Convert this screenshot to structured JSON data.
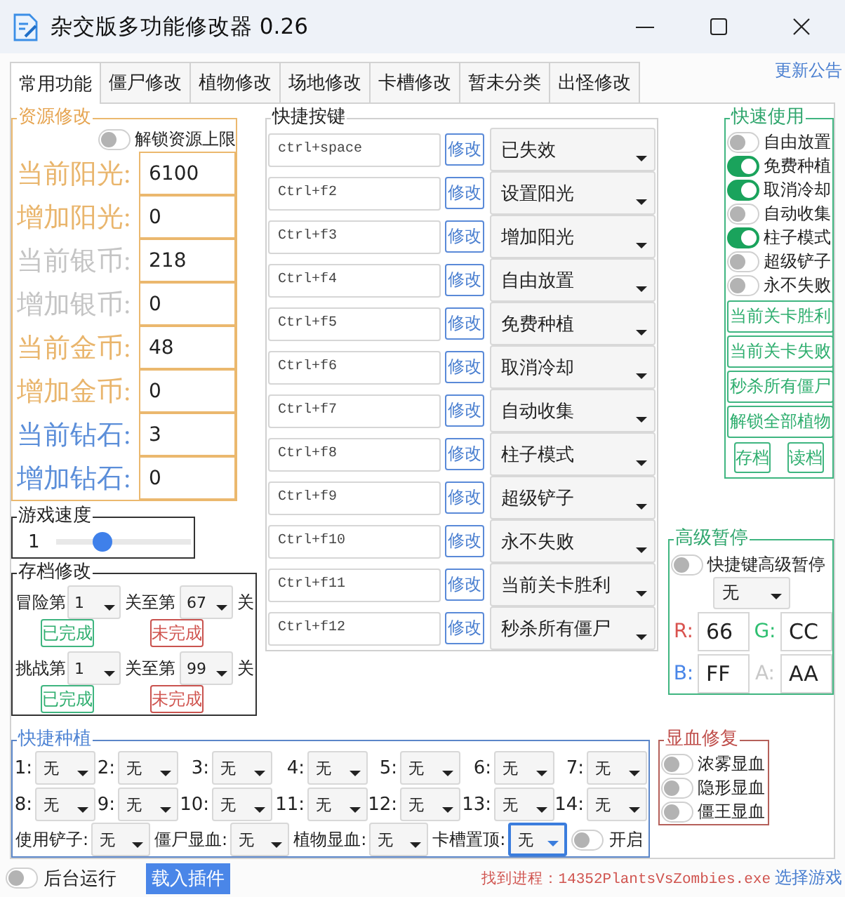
{
  "window": {
    "title": "杂交版多功能修改器 0.26"
  },
  "tabs": [
    {
      "label": "常用功能",
      "selected": true
    },
    {
      "label": "僵尸修改",
      "selected": false
    },
    {
      "label": "植物修改",
      "selected": false
    },
    {
      "label": "场地修改",
      "selected": false
    },
    {
      "label": "卡槽修改",
      "selected": false
    },
    {
      "label": "暂未分类",
      "selected": false
    },
    {
      "label": "出怪修改",
      "selected": false
    }
  ],
  "update_link": "更新公告",
  "resources": {
    "title": "资源修改",
    "unlock_toggle": {
      "label": "解锁资源上限",
      "on": false
    },
    "fields": [
      {
        "label": "当前阳光:",
        "value": "6100",
        "color": "#e9b56c"
      },
      {
        "label": "增加阳光:",
        "value": "0",
        "color": "#e9b56c"
      },
      {
        "label": "当前银币:",
        "value": "218",
        "color": "#c4c4c4"
      },
      {
        "label": "增加银币:",
        "value": "0",
        "color": "#c4c4c4"
      },
      {
        "label": "当前金币:",
        "value": "48",
        "color": "#e9b56c"
      },
      {
        "label": "增加金币:",
        "value": "0",
        "color": "#e9b56c"
      },
      {
        "label": "当前钻石:",
        "value": "3",
        "color": "#5b8ed9"
      },
      {
        "label": "增加钻石:",
        "value": "0",
        "color": "#5b8ed9"
      }
    ]
  },
  "game_speed": {
    "title": "游戏速度",
    "value": "1",
    "level": 0.32
  },
  "save_edit": {
    "title": "存档修改",
    "rows": [
      {
        "label": "冒险第",
        "from": "1",
        "middle": "关至第",
        "to": "67",
        "end": "关",
        "done_button": "已完成",
        "undone_button": "未完成"
      },
      {
        "label": "挑战第",
        "from": "1",
        "middle": "关至第",
        "to": "99",
        "end": "关",
        "done_button": "已完成",
        "undone_button": "未完成"
      }
    ]
  },
  "hotkeys": {
    "title": "快捷按键",
    "rows": [
      {
        "key": "ctrl+space",
        "button": "修改",
        "action": "已失效"
      },
      {
        "key": "Ctrl+f2",
        "button": "修改",
        "action": "设置阳光"
      },
      {
        "key": "Ctrl+f3",
        "button": "修改",
        "action": "增加阳光"
      },
      {
        "key": "Ctrl+f4",
        "button": "修改",
        "action": "自由放置"
      },
      {
        "key": "Ctrl+f5",
        "button": "修改",
        "action": "免费种植"
      },
      {
        "key": "Ctrl+f6",
        "button": "修改",
        "action": "取消冷却"
      },
      {
        "key": "Ctrl+f7",
        "button": "修改",
        "action": "自动收集"
      },
      {
        "key": "Ctrl+f8",
        "button": "修改",
        "action": "柱子模式"
      },
      {
        "key": "Ctrl+f9",
        "button": "修改",
        "action": "超级铲子"
      },
      {
        "key": "Ctrl+f10",
        "button": "修改",
        "action": "永不失败"
      },
      {
        "key": "Ctrl+f11",
        "button": "修改",
        "action": "当前关卡胜利"
      },
      {
        "key": "Ctrl+f12",
        "button": "修改",
        "action": "秒杀所有僵尸"
      }
    ]
  },
  "quick_use": {
    "title": "快速使用",
    "toggles": [
      {
        "label": "自由放置",
        "on": false
      },
      {
        "label": "免费种植",
        "on": true
      },
      {
        "label": "取消冷却",
        "on": true
      },
      {
        "label": "自动收集",
        "on": false
      },
      {
        "label": "柱子模式",
        "on": true
      },
      {
        "label": "超级铲子",
        "on": false
      },
      {
        "label": "永不失败",
        "on": false
      }
    ],
    "buttons": [
      "当前关卡胜利",
      "当前关卡失败",
      "秒杀所有僵尸",
      "解锁全部植物"
    ],
    "save_buttons": [
      "存档",
      "读档"
    ]
  },
  "advanced_pause": {
    "title": "高级暂停",
    "toggle": {
      "label": "快捷键高级暂停",
      "on": false
    },
    "select": "无",
    "channels": [
      {
        "label": "R:",
        "value": "66",
        "color": "#d9534f"
      },
      {
        "label": "G:",
        "value": "CC",
        "color": "#2fbf71"
      },
      {
        "label": "B:",
        "value": "FF",
        "color": "#4a86e8"
      },
      {
        "label": "A:",
        "value": "AA",
        "color": "#c8c8c8"
      }
    ]
  },
  "quick_plant": {
    "title": "快捷种植",
    "slots": [
      {
        "label": "1:",
        "value": "无"
      },
      {
        "label": "2:",
        "value": "无"
      },
      {
        "label": "3:",
        "value": "无"
      },
      {
        "label": "4:",
        "value": "无"
      },
      {
        "label": "5:",
        "value": "无"
      },
      {
        "label": "6:",
        "value": "无"
      },
      {
        "label": "7:",
        "value": "无"
      },
      {
        "label": "8:",
        "value": "无"
      },
      {
        "label": "9:",
        "value": "无"
      },
      {
        "label": "10:",
        "value": "无"
      },
      {
        "label": "11:",
        "value": "无"
      },
      {
        "label": "12:",
        "value": "无"
      },
      {
        "label": "13:",
        "value": "无"
      },
      {
        "label": "14:",
        "value": "无"
      }
    ],
    "options": [
      {
        "label": "使用铲子:",
        "value": "无",
        "focused": false
      },
      {
        "label": "僵尸显血:",
        "value": "无",
        "focused": false
      },
      {
        "label": "植物显血:",
        "value": "无",
        "focused": false
      },
      {
        "label": "卡槽置顶:",
        "value": "无",
        "focused": true
      }
    ],
    "toggle": {
      "label": "开启",
      "on": false
    }
  },
  "blood_fix": {
    "title": "显血修复",
    "toggles": [
      {
        "label": "浓雾显血",
        "on": false
      },
      {
        "label": "隐形显血",
        "on": false
      },
      {
        "label": "僵王显血",
        "on": false
      }
    ]
  },
  "status_bar": {
    "background_toggle": {
      "label": "后台运行",
      "on": false
    },
    "plugin_button": "载入插件",
    "process_text": "找到进程：14352PlantsVsZombies.exe",
    "select_game_link": "选择游戏"
  }
}
